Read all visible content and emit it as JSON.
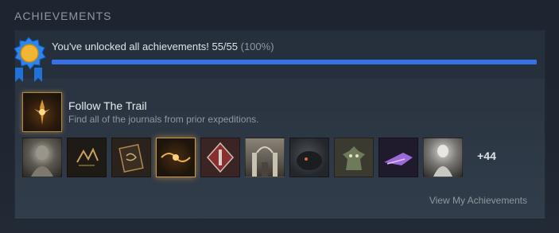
{
  "section": {
    "title": "ACHIEVEMENTS"
  },
  "progress": {
    "text": "You've unlocked all achievements! 55/55",
    "percent_text": "(100%)",
    "fraction": 1.0,
    "bar_color": "#3572ea"
  },
  "badge": {
    "icon": "award-ribbon-icon",
    "color_outer": "#1f72d9",
    "color_inner": "#f2b632"
  },
  "featured": {
    "title": "Follow The Trail",
    "description": "Find all of the journals from prior expeditions."
  },
  "thumbnails": [
    {
      "name": "achievement-thumb-1",
      "icon": "stone-figure-icon",
      "active": false
    },
    {
      "name": "achievement-thumb-2",
      "icon": "gold-runes-icon",
      "active": false
    },
    {
      "name": "achievement-thumb-3",
      "icon": "journal-icon",
      "active": false
    },
    {
      "name": "achievement-thumb-4",
      "icon": "golden-glyph-icon",
      "active": true
    },
    {
      "name": "achievement-thumb-5",
      "icon": "red-diamond-icon",
      "active": false
    },
    {
      "name": "achievement-thumb-6",
      "icon": "cathedral-icon",
      "active": false
    },
    {
      "name": "achievement-thumb-7",
      "icon": "dark-creature-icon",
      "active": false
    },
    {
      "name": "achievement-thumb-8",
      "icon": "goblin-icon",
      "active": false
    },
    {
      "name": "achievement-thumb-9",
      "icon": "purple-ship-icon",
      "active": false
    },
    {
      "name": "achievement-thumb-10",
      "icon": "pale-figure-icon",
      "active": false
    }
  ],
  "more_count": "+44",
  "view_link": "View My Achievements",
  "accent_gold": "#c99a4a"
}
